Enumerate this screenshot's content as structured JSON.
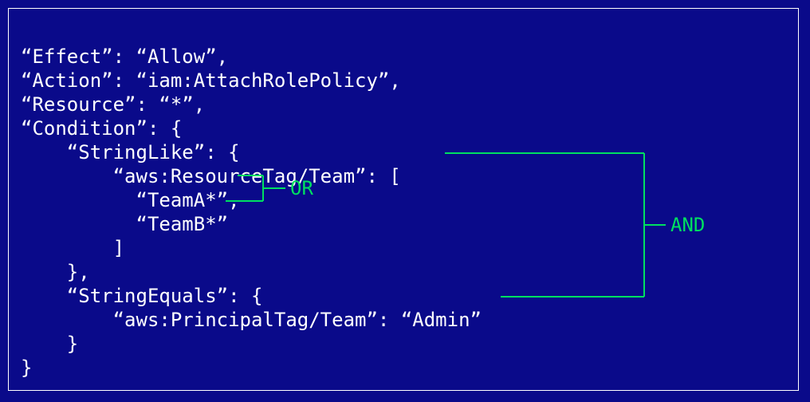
{
  "policy": {
    "line1": "“Effect”: “Allow”,",
    "line2": "“Action”: “iam:AttachRolePolicy”,",
    "line3": "“Resource”: “*”,",
    "line4": "“Condition”: {",
    "line5": "    “StringLike”: {",
    "line6": "        “aws:ResourceTag/Team”: [",
    "line7": "          “TeamA*”,",
    "line8": "          “TeamB*”",
    "line9": "        ]",
    "line10": "    },",
    "line11": "    “StringEquals”: {",
    "line12": "        “aws:PrincipalTag/Team”: “Admin”",
    "line13": "    }",
    "line14": "}"
  },
  "labels": {
    "or": "OR",
    "and": "AND"
  },
  "colors": {
    "background": "#0a0a8a",
    "text": "#ffffff",
    "accent": "#00e060",
    "border": "#ffffff"
  }
}
